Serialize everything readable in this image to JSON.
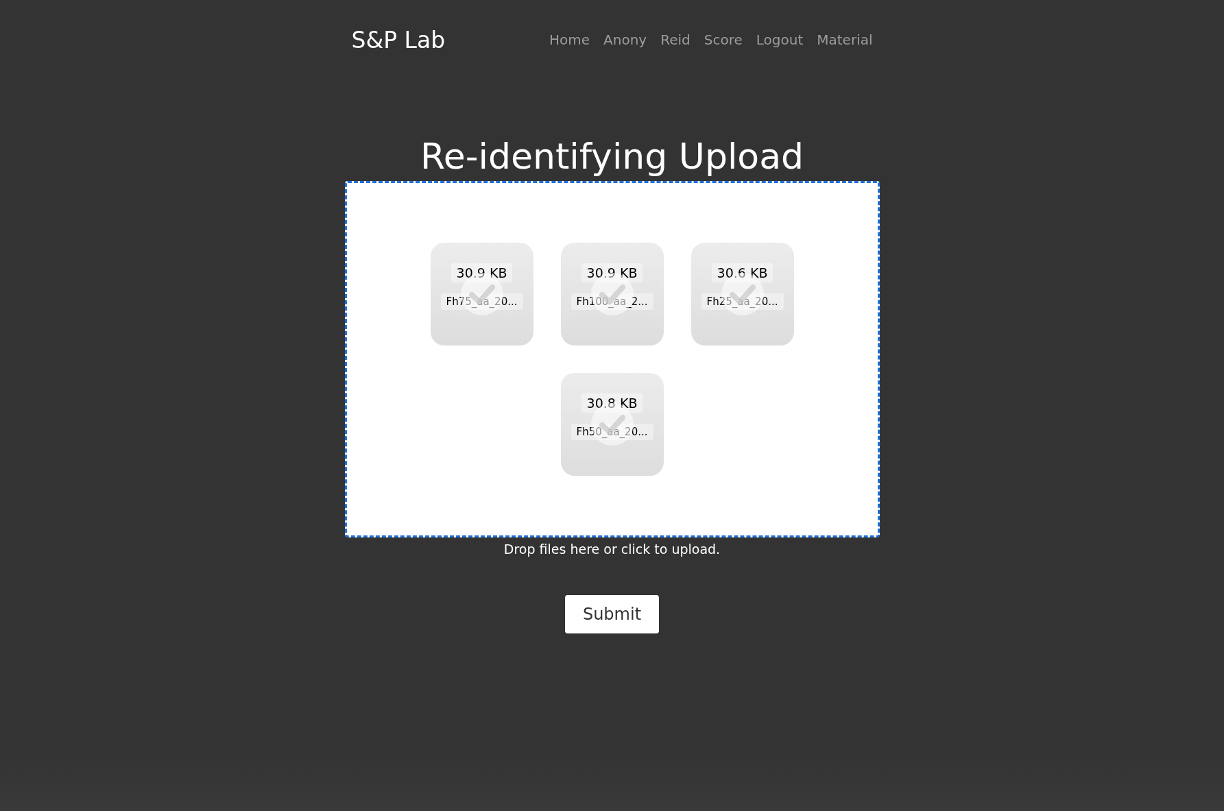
{
  "navbar": {
    "brand": "S&P Lab",
    "links": [
      {
        "label": "Home"
      },
      {
        "label": "Anony"
      },
      {
        "label": "Reid"
      },
      {
        "label": "Score"
      },
      {
        "label": "Logout"
      },
      {
        "label": "Material"
      }
    ]
  },
  "title": "Re-identifying Upload",
  "dropzone": {
    "files": [
      {
        "size": "30.9 KB",
        "name": "Fh75_aa_20...",
        "success": true
      },
      {
        "size": "30.9 KB",
        "name": "Fh100_aa_2...",
        "success": true
      },
      {
        "size": "30.6 KB",
        "name": "Fh25_aa_20...",
        "success": true
      },
      {
        "size": "30.8 KB",
        "name": "Fh50_aa_20...",
        "success": true
      }
    ],
    "hint": "Drop files here or click to upload."
  },
  "submit": "Submit"
}
